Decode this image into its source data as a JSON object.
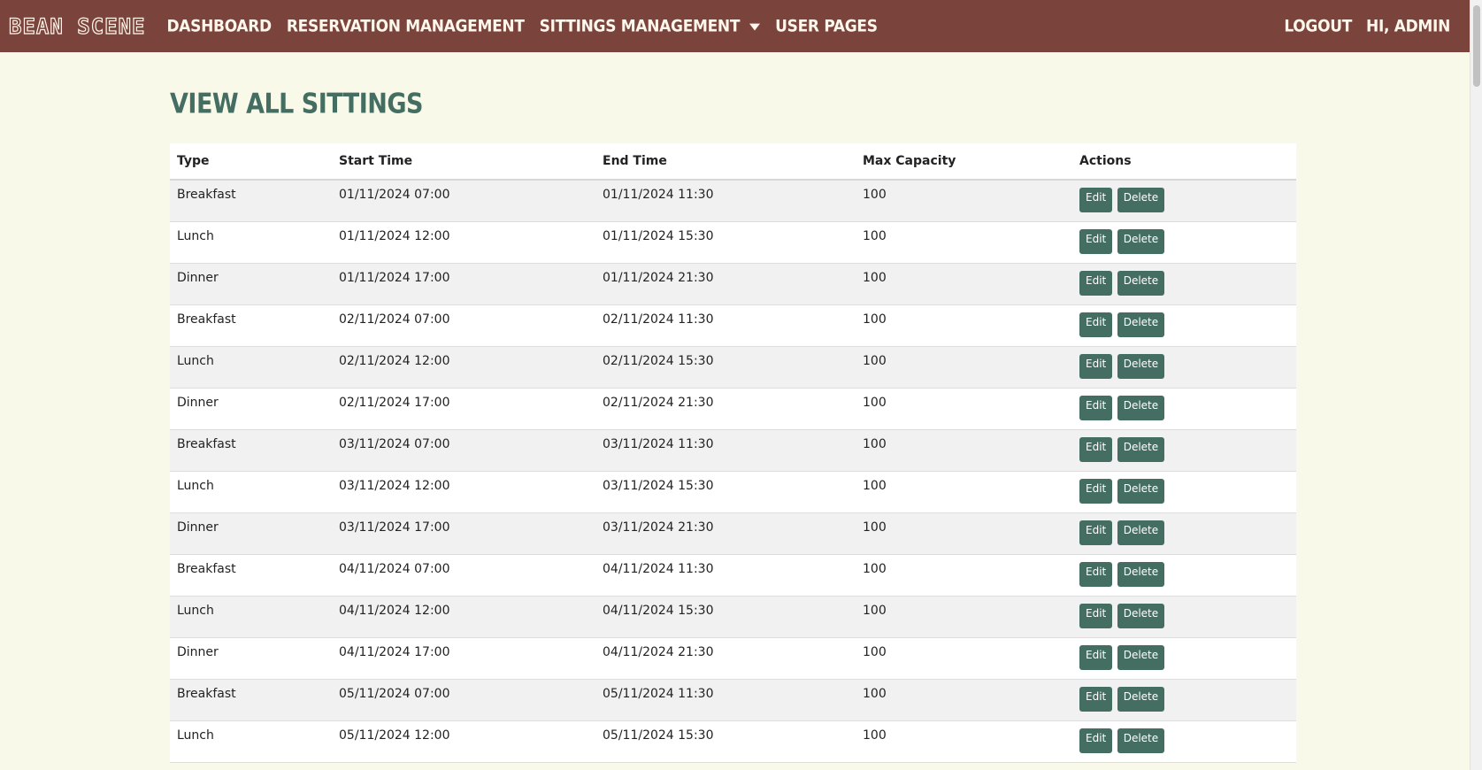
{
  "navbar": {
    "brand": "Bean Scene",
    "links": [
      {
        "label": "Dashboard"
      },
      {
        "label": "Reservation Management"
      },
      {
        "label": "Sittings Management"
      },
      {
        "label": "User Pages"
      }
    ],
    "right_links": [
      {
        "label": "Logout"
      },
      {
        "label": "Hi, Admin"
      }
    ],
    "background_color": "#7a443c"
  },
  "page": {
    "title": "View All Sittings",
    "title_color": "#456e63",
    "background_color": "#f8f9e9"
  },
  "table": {
    "headers": [
      "Type",
      "Start Time",
      "End Time",
      "Max Capacity",
      "Actions"
    ],
    "edit_label": "Edit",
    "delete_label": "Delete",
    "button_color": "#456e63",
    "rows": [
      {
        "type": "Breakfast",
        "start": "01/11/2024 07:00",
        "end": "01/11/2024 11:30",
        "capacity": "100"
      },
      {
        "type": "Lunch",
        "start": "01/11/2024 12:00",
        "end": "01/11/2024 15:30",
        "capacity": "100"
      },
      {
        "type": "Dinner",
        "start": "01/11/2024 17:00",
        "end": "01/11/2024 21:30",
        "capacity": "100"
      },
      {
        "type": "Breakfast",
        "start": "02/11/2024 07:00",
        "end": "02/11/2024 11:30",
        "capacity": "100"
      },
      {
        "type": "Lunch",
        "start": "02/11/2024 12:00",
        "end": "02/11/2024 15:30",
        "capacity": "100"
      },
      {
        "type": "Dinner",
        "start": "02/11/2024 17:00",
        "end": "02/11/2024 21:30",
        "capacity": "100"
      },
      {
        "type": "Breakfast",
        "start": "03/11/2024 07:00",
        "end": "03/11/2024 11:30",
        "capacity": "100"
      },
      {
        "type": "Lunch",
        "start": "03/11/2024 12:00",
        "end": "03/11/2024 15:30",
        "capacity": "100"
      },
      {
        "type": "Dinner",
        "start": "03/11/2024 17:00",
        "end": "03/11/2024 21:30",
        "capacity": "100"
      },
      {
        "type": "Breakfast",
        "start": "04/11/2024 07:00",
        "end": "04/11/2024 11:30",
        "capacity": "100"
      },
      {
        "type": "Lunch",
        "start": "04/11/2024 12:00",
        "end": "04/11/2024 15:30",
        "capacity": "100"
      },
      {
        "type": "Dinner",
        "start": "04/11/2024 17:00",
        "end": "04/11/2024 21:30",
        "capacity": "100"
      },
      {
        "type": "Breakfast",
        "start": "05/11/2024 07:00",
        "end": "05/11/2024 11:30",
        "capacity": "100"
      },
      {
        "type": "Lunch",
        "start": "05/11/2024 12:00",
        "end": "05/11/2024 15:30",
        "capacity": "100"
      }
    ]
  }
}
